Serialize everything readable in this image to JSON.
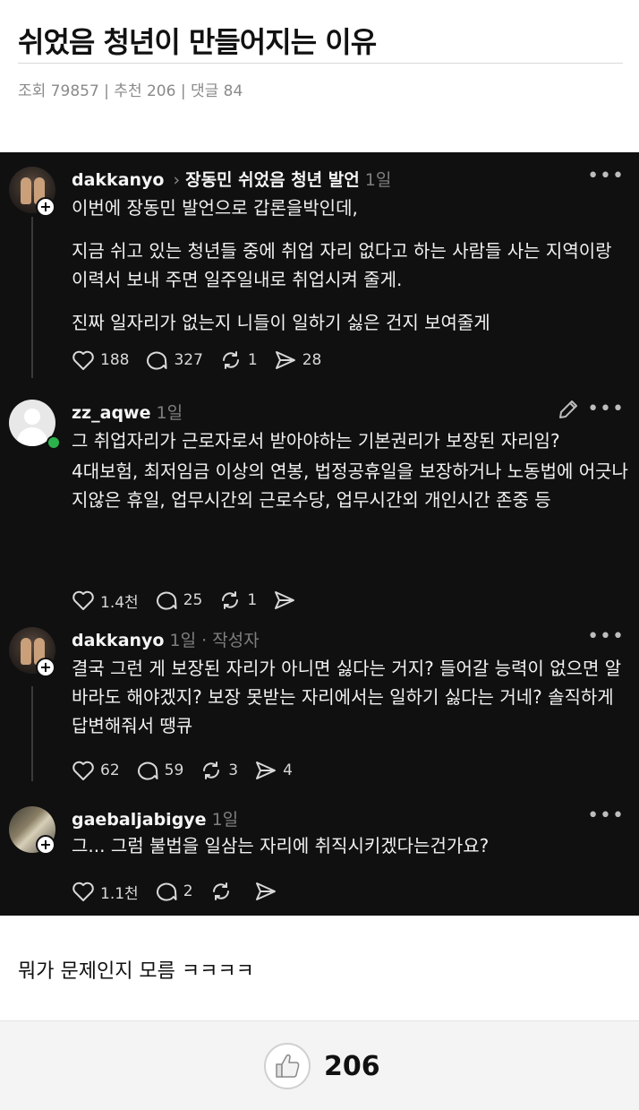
{
  "post": {
    "title": "쉬었음 청년이 만들어지는 이유",
    "meta": "조회 79857 | 추천 206 | 댓글 84"
  },
  "comments": [
    {
      "username": "dakkanyo",
      "reply_to": "장동민 쉬었음 청년 발언",
      "time": "1일",
      "paragraphs": [
        "이번에 장동민 발언으로 갑론을박인데,",
        "지금 쉬고 있는 청년들 중에 취업 자리 없다고 하는 사람들 사는 지역이랑 이력서 보내 주면 일주일내로 취업시켜 줄게.",
        "진짜 일자리가 없는지 니들이 일하기 싫은 건지 보여줄게"
      ],
      "likes": "188",
      "replies": "327",
      "reposts": "1",
      "shares": "28"
    },
    {
      "username": "zz_aqwe",
      "time": "1일",
      "paragraphs": [
        "그 취업자리가 근로자로서 받아야하는 기본권리가 보장된 자리임?",
        "4대보험, 최저임금 이상의 연봉, 법정공휴일을 보장하거나 노동법에 어긋나지않은 휴일, 업무시간외 근로수당, 업무시간외 개인시간 존중 등"
      ],
      "likes": "1.4천",
      "replies": "25",
      "reposts": "1",
      "shares": ""
    },
    {
      "username": "dakkanyo",
      "time": "1일",
      "author_tag": "· 작성자",
      "paragraphs": [
        "결국 그런 게 보장된 자리가 아니면 싫다는 거지? 들어갈 능력이 없으면 알바라도 해야겠지? 보장 못받는 자리에서는 일하기 싫다는 거네? 솔직하게 답변해줘서 땡큐"
      ],
      "likes": "62",
      "replies": "59",
      "reposts": "3",
      "shares": "4"
    },
    {
      "username": "gaebaljabigye",
      "time": "1일",
      "paragraphs": [
        "그... 그럼 불법을 일삼는 자리에 취직시키겠다는건가요?"
      ],
      "likes": "1.1천",
      "replies": "2",
      "reposts": "",
      "shares": ""
    }
  ],
  "after_image_text": "뭐가 문제인지 모름 ㅋㅋㅋㅋ",
  "recommend": {
    "count": "206"
  },
  "colors": {
    "thread_bg": "#101010",
    "online": "#2bb24c"
  },
  "icons": [
    "heart-icon",
    "comment-icon",
    "repost-icon",
    "share-icon",
    "more-icon",
    "pencil-icon",
    "thumbs-up-icon"
  ]
}
